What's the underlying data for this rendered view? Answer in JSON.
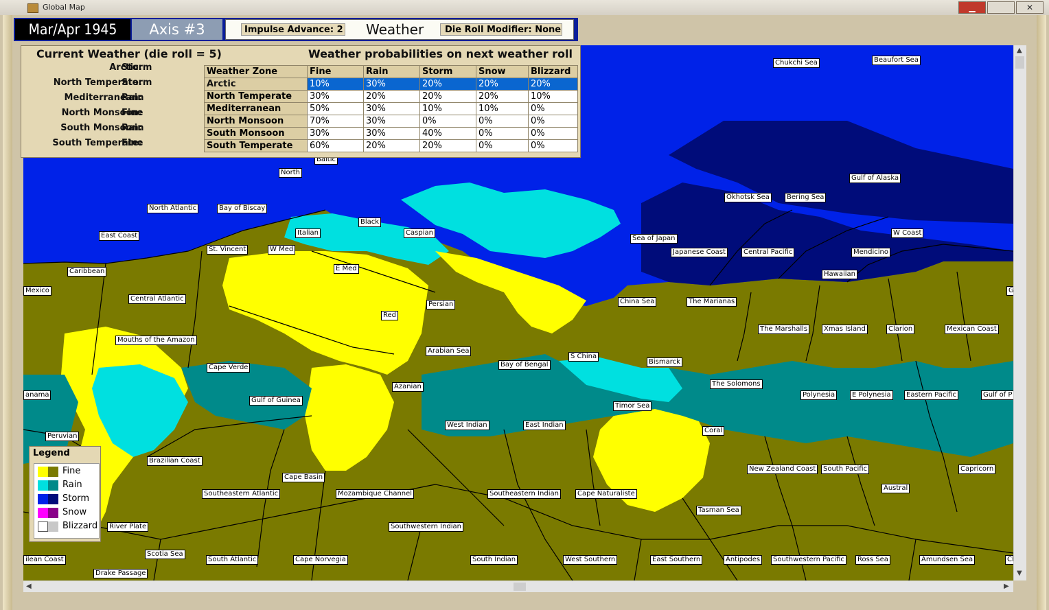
{
  "window": {
    "title": "Global Map"
  },
  "header": {
    "date": "Mar/Apr 1945",
    "phase": "Axis #3",
    "impulse_label": "Impulse Advance:",
    "impulse_value": "2",
    "weather_label": "Weather",
    "die_label": "Die Roll Modifier:",
    "die_value": "None"
  },
  "current_weather": {
    "title": "Current Weather (die roll = 5)",
    "zones": [
      {
        "label": "Arctic:",
        "value": "Storm"
      },
      {
        "label": "North Temperate:",
        "value": "Storm"
      },
      {
        "label": "Mediterranean:",
        "value": "Rain"
      },
      {
        "label": "North Monsoon:",
        "value": "Fine"
      },
      {
        "label": "South Monsoon:",
        "value": "Rain"
      },
      {
        "label": "South Temperate:",
        "value": "Fine"
      }
    ]
  },
  "probabilities": {
    "title": "Weather probabilities on next weather roll",
    "columns": [
      "Weather Zone",
      "Fine",
      "Rain",
      "Storm",
      "Snow",
      "Blizzard"
    ],
    "rows": [
      {
        "zone": "Arctic",
        "values": [
          "10%",
          "30%",
          "20%",
          "20%",
          "20%"
        ],
        "selected": true
      },
      {
        "zone": "North Temperate",
        "values": [
          "30%",
          "20%",
          "20%",
          "20%",
          "10%"
        ]
      },
      {
        "zone": "Mediterranean",
        "values": [
          "50%",
          "30%",
          "10%",
          "10%",
          "0%"
        ]
      },
      {
        "zone": "North Monsoon",
        "values": [
          "70%",
          "30%",
          "0%",
          "0%",
          "0%"
        ]
      },
      {
        "zone": "South Monsoon",
        "values": [
          "30%",
          "30%",
          "40%",
          "0%",
          "0%"
        ]
      },
      {
        "zone": "South Temperate",
        "values": [
          "60%",
          "20%",
          "20%",
          "0%",
          "0%"
        ]
      }
    ]
  },
  "legend": {
    "title": "Legend",
    "items": [
      {
        "label": "Fine",
        "c1": "#ffff00",
        "c2": "#7a7a00"
      },
      {
        "label": "Rain",
        "c1": "#00e0e0",
        "c2": "#008a8a"
      },
      {
        "label": "Storm",
        "c1": "#0022e8",
        "c2": "#000c7a"
      },
      {
        "label": "Snow",
        "c1": "#ff00ff",
        "c2": "#8a008a"
      },
      {
        "label": "Blizzard",
        "c1": "#ffffff",
        "c2": "#c8c8c8"
      }
    ]
  },
  "map_labels": [
    "Chukchi Sea",
    "Beaufort Sea",
    "Baltic",
    "North",
    "North Atlantic",
    "Bay of Biscay",
    "Black",
    "Caspian",
    "Italian",
    "St. Vincent",
    "W Med",
    "E Med",
    "East Coast",
    "Caribbean",
    "Mexico",
    "Central Atlantic",
    "Persian",
    "Red",
    "Mouths of the Amazon",
    "Arabian Sea",
    "Cape Verde",
    "Azanian",
    "Gulf of Guinea",
    "Bay of Bengal",
    "S China",
    "West Indian",
    "East Indian",
    "Peruvian",
    "Brazilian Coast",
    "Cape Basin",
    "Southeastern Atlantic",
    "Mozambique Channel",
    "Southeastern Indian",
    "Cape Naturaliste",
    "River Plate",
    "Southwestern Indian",
    "Scotia Sea",
    "South Atlantic",
    "Cape Norvegia",
    "South Indian",
    "West Southern",
    "East Southern",
    "Antipodes",
    "Southwestern Pacific",
    "Ross Sea",
    "Amundsen Sea",
    "Drake Passage",
    "ilean Coast",
    "anama",
    "Okhotsk Sea",
    "Bering Sea",
    "Gulf of Alaska",
    "Sea of Japan",
    "Japanese Coast",
    "Central Pacific",
    "W Coast",
    "Mendicino",
    "Hawaiian",
    "China Sea",
    "The Marianas",
    "The Marshalls",
    "Xmas Island",
    "Clarion",
    "Mexican Coast",
    "Bismarck",
    "The Solomons",
    "Polynesia",
    "E Polynesia",
    "Eastern Pacific",
    "Gulf of P",
    "Timor Sea",
    "Coral",
    "New Zealand Coast",
    "South Pacific",
    "Capricorn",
    "Austral",
    "Tasman Sea",
    "G",
    "Ch"
  ]
}
